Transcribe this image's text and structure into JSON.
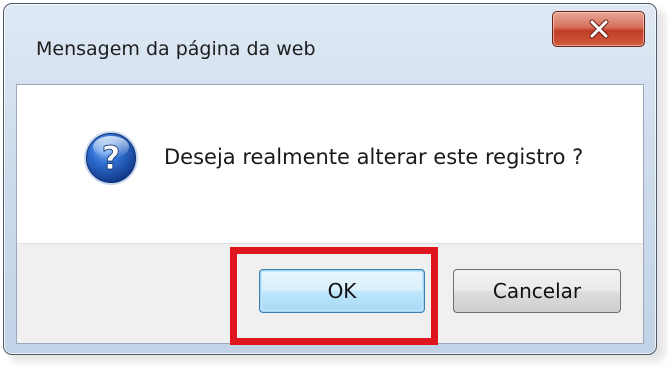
{
  "dialog": {
    "title": "Mensagem da página da web",
    "message": "Deseja realmente alterar este registro ?",
    "icon": "question-icon",
    "buttons": {
      "ok_label": "OK",
      "cancel_label": "Cancelar"
    },
    "close_icon": "close-icon"
  },
  "annotation": {
    "highlight_color": "#e0161e",
    "highlighted_element": "ok-button"
  },
  "colors": {
    "close_button": "#c23e26",
    "icon_blue": "#2f6fd0",
    "highlight": "#e0161e"
  }
}
